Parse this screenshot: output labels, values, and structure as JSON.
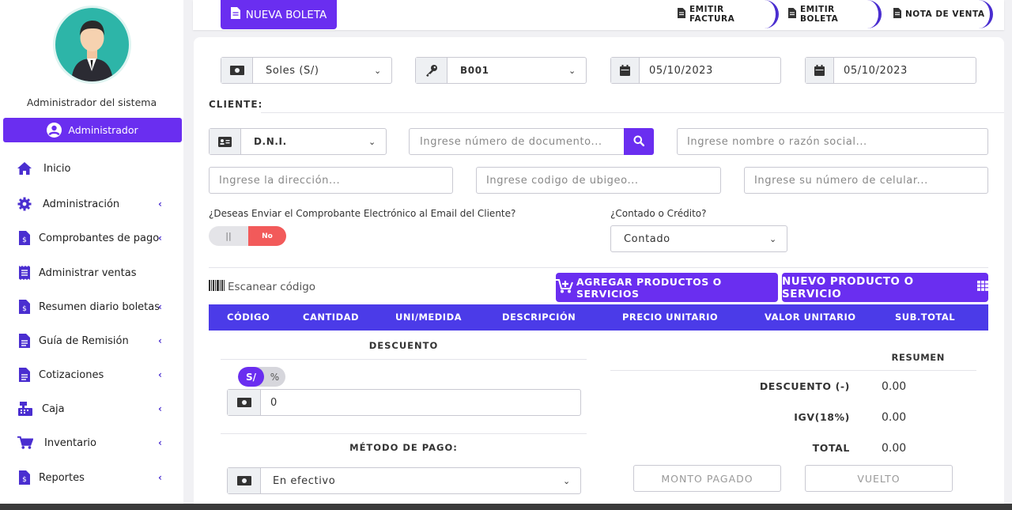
{
  "sidebar": {
    "admin_name": "Administrador del sistema",
    "role": "Administrador",
    "items": [
      {
        "label": "Inicio",
        "icon": "home-icon",
        "chevron": ""
      },
      {
        "label": "Administración",
        "icon": "gear-icon",
        "chevron": "‹"
      },
      {
        "label": "Comprobantes de pago",
        "icon": "invoice-icon",
        "chevron": "‹"
      },
      {
        "label": "Administrar ventas",
        "icon": "receipt-icon",
        "chevron": ""
      },
      {
        "label": "Resumen diario boletas",
        "icon": "invoice-icon",
        "chevron": "‹"
      },
      {
        "label": "Guía de Remisión",
        "icon": "document-icon",
        "chevron": "‹"
      },
      {
        "label": "Cotizaciones",
        "icon": "document-icon",
        "chevron": "‹"
      },
      {
        "label": "Caja",
        "icon": "cash-register-icon",
        "chevron": "‹"
      },
      {
        "label": "Inventario",
        "icon": "cart-icon",
        "chevron": "‹"
      },
      {
        "label": "Reportes",
        "icon": "invoice-icon",
        "chevron": "‹"
      }
    ]
  },
  "topbar": {
    "new_button": "NUEVA BOLETA",
    "tabs": [
      "EMITIR FACTURA",
      "EMITIR BOLETA",
      "NOTA DE VENTA"
    ]
  },
  "form": {
    "currency": "Soles (S/)",
    "series": "B001",
    "date_issue": "05/10/2023",
    "date_due": "05/10/2023",
    "client_label": "CLIENTE:",
    "doc_type": "D.N.I.",
    "doc_number_placeholder": "Ingrese número de documento...",
    "name_placeholder": "Ingrese nombre o razón social...",
    "address_placeholder": "Ingrese la dirección...",
    "ubigeo_placeholder": "Ingrese codigo de ubigeo...",
    "phone_placeholder": "Ingrese su número de celular...",
    "email_question": "¿Deseas Enviar el Comprobante Electrónico al Email del Cliente?",
    "toggle_left": "||",
    "toggle_right": "No",
    "credit_question": "¿Contado o Crédito?",
    "payment_type": "Contado"
  },
  "products": {
    "scan_label": "Escanear código",
    "add_button": "AGREGAR PRODUCTOS O SERVICIOS",
    "new_button": "NUEVO PRODUCTO O SERVICIO",
    "columns": [
      "CÓDIGO",
      "CANTIDAD",
      "UNI/MEDIDA",
      "DESCRIPCIÓN",
      "PRECIO UNITARIO",
      "VALOR UNITARIO",
      "SUB.TOTAL"
    ]
  },
  "discount": {
    "title": "DESCUENTO",
    "opt_a": "S/",
    "opt_b": "%",
    "value": "0"
  },
  "payment": {
    "title": "MÉTODO DE PAGO:",
    "method": "En efectivo"
  },
  "summary": {
    "title": "RESUMEN",
    "discount_label": "DESCUENTO (-)",
    "discount_value": "0.00",
    "igv_label": "IGV(18%)",
    "igv_value": "0.00",
    "total_label": "TOTAL",
    "total_value": "0.00",
    "paid_button": "MONTO PAGADO",
    "change_button": "VUELTO"
  },
  "colors": {
    "accent": "#6a2ef0",
    "table_header": "#4b3be8",
    "toggle_off": "#f25a5a",
    "avatar_bg": "#2db5a8"
  }
}
